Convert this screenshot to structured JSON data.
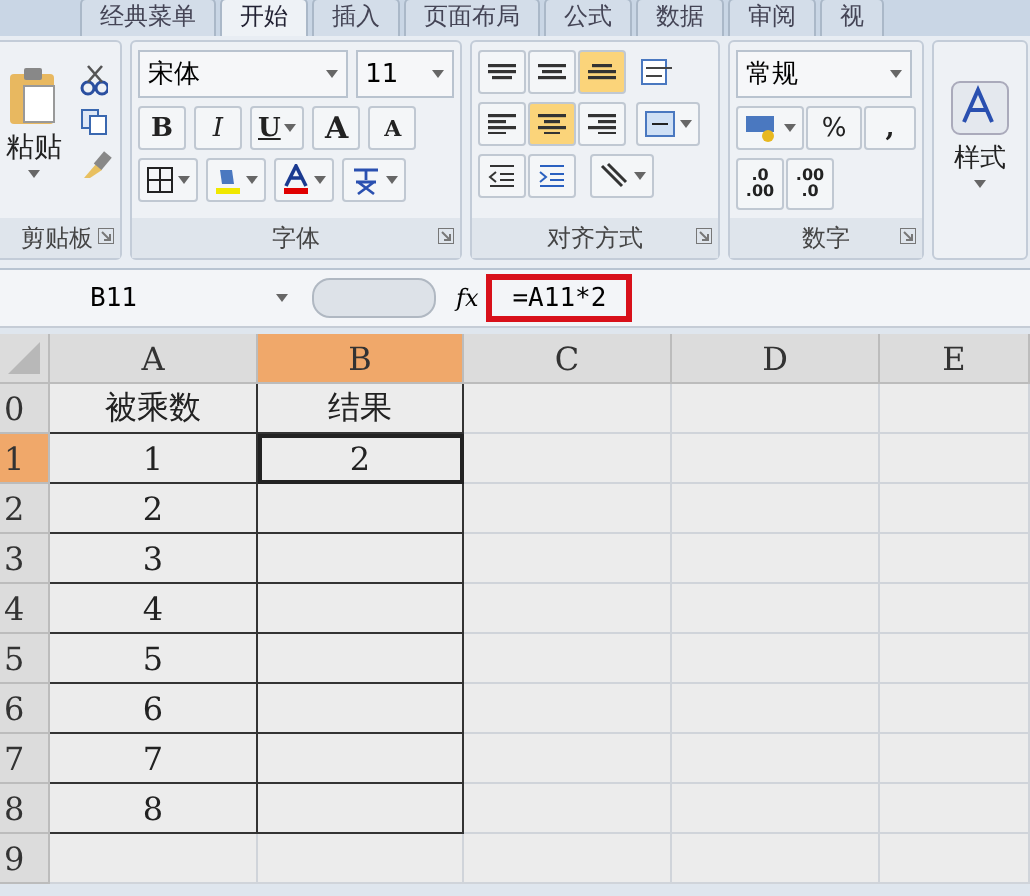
{
  "tabs": [
    {
      "label": "经典菜单",
      "selected": false
    },
    {
      "label": "开始",
      "selected": true
    },
    {
      "label": "插入",
      "selected": false
    },
    {
      "label": "页面布局",
      "selected": false
    },
    {
      "label": "公式",
      "selected": false
    },
    {
      "label": "数据",
      "selected": false
    },
    {
      "label": "审阅",
      "selected": false
    },
    {
      "label": "视",
      "selected": false
    }
  ],
  "ribbon": {
    "clipboard": {
      "paste_label": "粘贴",
      "group_label": "剪贴板"
    },
    "font": {
      "font_name": "宋体",
      "font_size": "11",
      "bold": "B",
      "italic": "I",
      "underline": "U",
      "grow": "A",
      "shrink": "A",
      "group_label": "字体"
    },
    "alignment": {
      "vertical": [
        {
          "kind": "top",
          "selected": false
        },
        {
          "kind": "middle",
          "selected": false
        },
        {
          "kind": "bottom",
          "selected": true
        }
      ],
      "horizontal": [
        {
          "kind": "left",
          "selected": false
        },
        {
          "kind": "center",
          "selected": true
        },
        {
          "kind": "right",
          "selected": false
        }
      ],
      "group_label": "对齐方式"
    },
    "number": {
      "format": "常规",
      "percent": "%",
      "comma": ",",
      "increase_decimal": ".0\n.00",
      "decrease_decimal": ".00\n.0",
      "group_label": "数字"
    },
    "styles": {
      "label": "样式"
    }
  },
  "formula_bar": {
    "name_box": "B11",
    "fx": "fx",
    "formula": "=A11*2",
    "highlighted": true
  },
  "sheet": {
    "columns": [
      {
        "label": "A",
        "selected": false
      },
      {
        "label": "B",
        "selected": true
      },
      {
        "label": "C",
        "selected": false
      },
      {
        "label": "D",
        "selected": false
      },
      {
        "label": "E",
        "selected": false
      }
    ],
    "rows": [
      {
        "header": "0",
        "selected": false,
        "table": true,
        "values": [
          "被乘数",
          "结果"
        ]
      },
      {
        "header": "1",
        "selected": true,
        "table": true,
        "values": [
          "1",
          "2"
        ]
      },
      {
        "header": "2",
        "selected": false,
        "table": true,
        "values": [
          "2"
        ]
      },
      {
        "header": "3",
        "selected": false,
        "table": true,
        "values": [
          "3"
        ]
      },
      {
        "header": "4",
        "selected": false,
        "table": true,
        "values": [
          "4"
        ]
      },
      {
        "header": "5",
        "selected": false,
        "table": true,
        "values": [
          "5"
        ]
      },
      {
        "header": "6",
        "selected": false,
        "table": true,
        "values": [
          "6"
        ]
      },
      {
        "header": "7",
        "selected": false,
        "table": true,
        "values": [
          "7"
        ]
      },
      {
        "header": "8",
        "selected": false,
        "table": true,
        "values": [
          "8"
        ]
      },
      {
        "header": "9",
        "selected": false,
        "table": false,
        "values": []
      }
    ]
  }
}
